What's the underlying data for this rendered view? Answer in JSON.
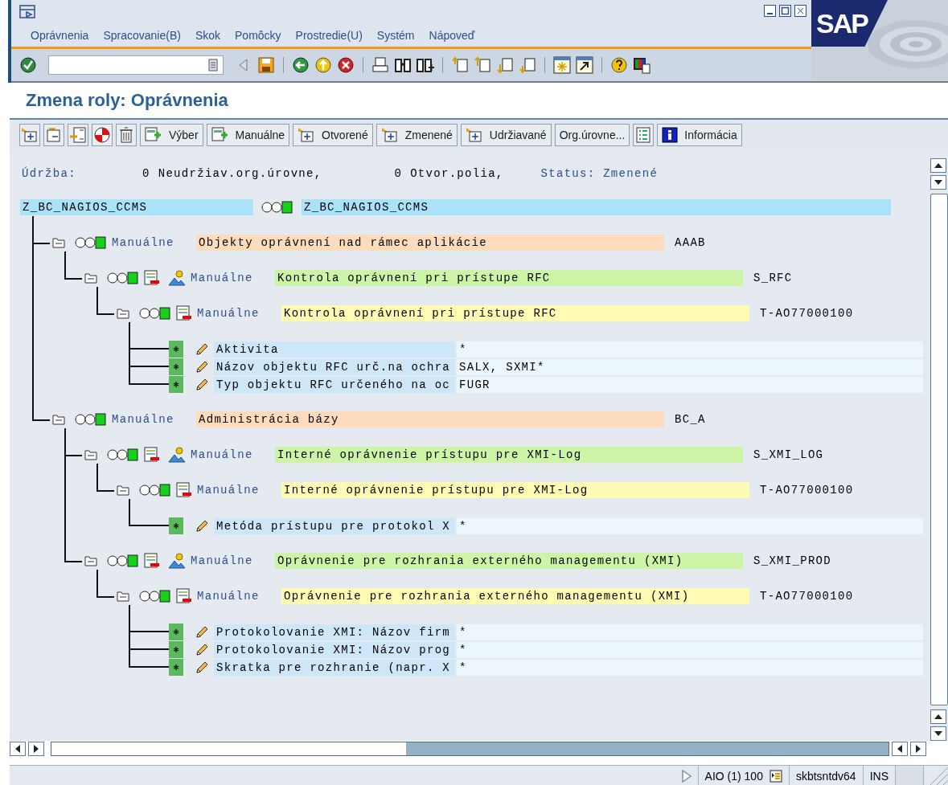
{
  "window": {
    "logo": "SAP"
  },
  "menu": [
    "Oprávnenia",
    "Spracovanie(B)",
    "Skok",
    "Pomôcky",
    "Prostredie(U)",
    "Systém",
    "Nápoveď"
  ],
  "title": "Zmena roly: Oprávnenia",
  "app_toolbar": [
    "Výber",
    "Manuálne",
    "Otvorené",
    "Zmenené",
    "Udržiavané",
    "Org.úrovne...",
    "Informácia"
  ],
  "summary": {
    "label": "Údržba:",
    "counts": [
      {
        "count": "0",
        "text": "Neudržiav.org.úrovne,"
      },
      {
        "count": "0",
        "text": "Otvor.polia,"
      }
    ],
    "status": "Status: Zmenené"
  },
  "role": {
    "name": "Z_BC_NAGIOS_CCMS",
    "title": "Z_BC_NAGIOS_CCMS",
    "children": [
      {
        "kind": "class",
        "expanded": true,
        "status": "Manuálne",
        "description": "Objekty oprávnení nad rámec aplikácie",
        "code": "AAAB",
        "children": [
          {
            "kind": "object",
            "expanded": true,
            "status": "Manuálne",
            "description": "Kontrola oprávnení pri prístupe RFC",
            "code": "S_RFC",
            "children": [
              {
                "kind": "authorization",
                "expanded": true,
                "status": "Manuálne",
                "description": "Kontrola oprávnení pri prístupe RFC",
                "code": "T-AO77000100",
                "fields": [
                  {
                    "label": "Aktivita",
                    "value": "*"
                  },
                  {
                    "label": "Názov objektu RFC urč.na ochra",
                    "value": "SALX, SXMI*"
                  },
                  {
                    "label": "Typ objektu RFC určeného na oc",
                    "value": "FUGR"
                  }
                ]
              }
            ]
          }
        ]
      },
      {
        "kind": "class",
        "expanded": true,
        "status": "Manuálne",
        "description": "Administrácia bázy",
        "code": "BC_A",
        "children": [
          {
            "kind": "object",
            "expanded": true,
            "status": "Manuálne",
            "description": "Interné oprávnenie prístupu pre XMI-Log",
            "code": "S_XMI_LOG",
            "children": [
              {
                "kind": "authorization",
                "expanded": true,
                "status": "Manuálne",
                "description": "Interné oprávnenie prístupu pre XMI-Log",
                "code": "T-AO77000100",
                "fields": [
                  {
                    "label": "Metóda prístupu pre protokol X",
                    "value": "*"
                  }
                ]
              }
            ]
          },
          {
            "kind": "object",
            "expanded": true,
            "status": "Manuálne",
            "description": "Oprávnenie pre rozhrania externého managementu (XMI)",
            "code": "S_XMI_PROD",
            "children": [
              {
                "kind": "authorization",
                "expanded": true,
                "status": "Manuálne",
                "description": "Oprávnenie pre rozhrania externého managementu (XMI)",
                "code": "T-AO77000100",
                "fields": [
                  {
                    "label": "Protokolovanie XMI: Názov firm",
                    "value": "*"
                  },
                  {
                    "label": "Protokolovanie XMI: Názov prog",
                    "value": "*"
                  },
                  {
                    "label": "Skratka pre rozhranie (napr. X",
                    "value": "*"
                  }
                ]
              }
            ]
          }
        ]
      }
    ]
  },
  "status_bar": {
    "session": "AIO (1) 100",
    "server": "skbtsntdv64",
    "mode": "INS"
  }
}
